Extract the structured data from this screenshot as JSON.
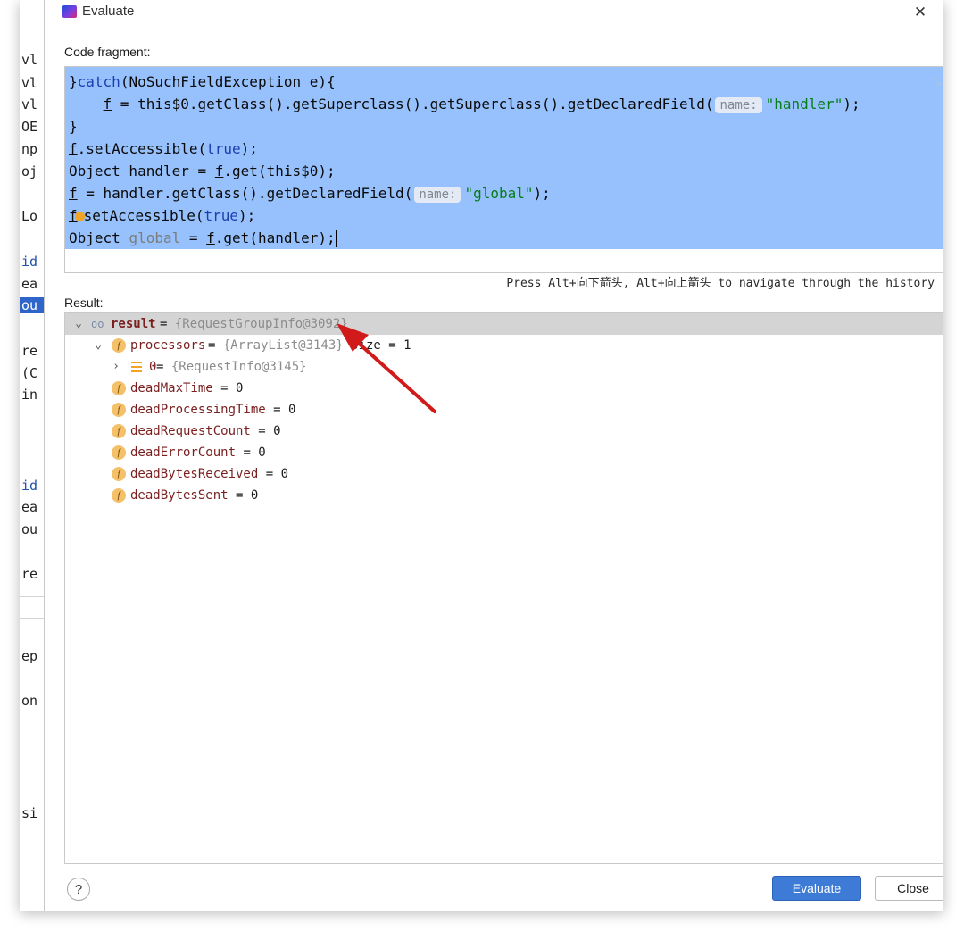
{
  "window": {
    "title": "Evaluate"
  },
  "ide_strip": {
    "fragments": [
      "vl",
      "vl",
      "vl",
      "OE",
      "np",
      "oj",
      "Lo",
      "id",
      "ea",
      "ou",
      "re",
      "(C",
      "in",
      "id",
      "ea",
      "ou",
      "re",
      "ep",
      "on",
      "si"
    ]
  },
  "code_fragment": {
    "label": "Code fragment:",
    "lines": {
      "l1_brace": "}",
      "l1_kw": "catch",
      "l1_rest": "(NoSuchFieldException e){",
      "l2_indent": "    ",
      "l2_var": "f",
      "l2_code": " = this$0.getClass().getSuperclass().getSuperclass().getDeclaredField(",
      "l2_hint": "name:",
      "l2_str": "\"handler\"",
      "l2_end": ");",
      "l3": "}",
      "l4_var": "f",
      "l4_code": ".setAccessible(",
      "l4_kw": "true",
      "l4_end": ");",
      "l5_code": "Object handler = ",
      "l5_var": "f",
      "l5_end": ".get(this$0);",
      "l6_var": "f",
      "l6_code": " = handler.getClass().getDeclaredField(",
      "l6_hint": "name:",
      "l6_str": "\"global\"",
      "l6_end": ");",
      "l7_var": "f",
      "l7_code": "setAccessible(",
      "l7_kw": "true",
      "l7_end": ");",
      "l8_code": "Object ",
      "l8_muted": "global",
      "l8_mid": " = ",
      "l8_var": "f",
      "l8_end": ".get(handler);"
    }
  },
  "history_hint": "Press Alt+向下箭头, Alt+向上箭头 to navigate through the history",
  "result": {
    "label": "Result:",
    "root": {
      "name": "result",
      "eq": " = ",
      "value": "{RequestGroupInfo@3092}"
    },
    "processors": {
      "name": "processors",
      "eq": " = ",
      "value": "{ArrayList@3143}",
      "size": "  size = 1"
    },
    "item0": {
      "name": "0",
      "eq": " = ",
      "value": "{RequestInfo@3145}"
    },
    "fields": [
      {
        "name": "deadMaxTime",
        "value": " = 0"
      },
      {
        "name": "deadProcessingTime",
        "value": " = 0"
      },
      {
        "name": "deadRequestCount",
        "value": " = 0"
      },
      {
        "name": "deadErrorCount",
        "value": " = 0"
      },
      {
        "name": "deadBytesReceived",
        "value": " = 0"
      },
      {
        "name": "deadBytesSent",
        "value": " = 0"
      }
    ]
  },
  "buttons": {
    "help": "?",
    "evaluate": "Evaluate",
    "close": "Close"
  },
  "colors": {
    "selection": "#97c1fc",
    "accent": "#3d7bd6",
    "annotation": "#d11b1b"
  }
}
